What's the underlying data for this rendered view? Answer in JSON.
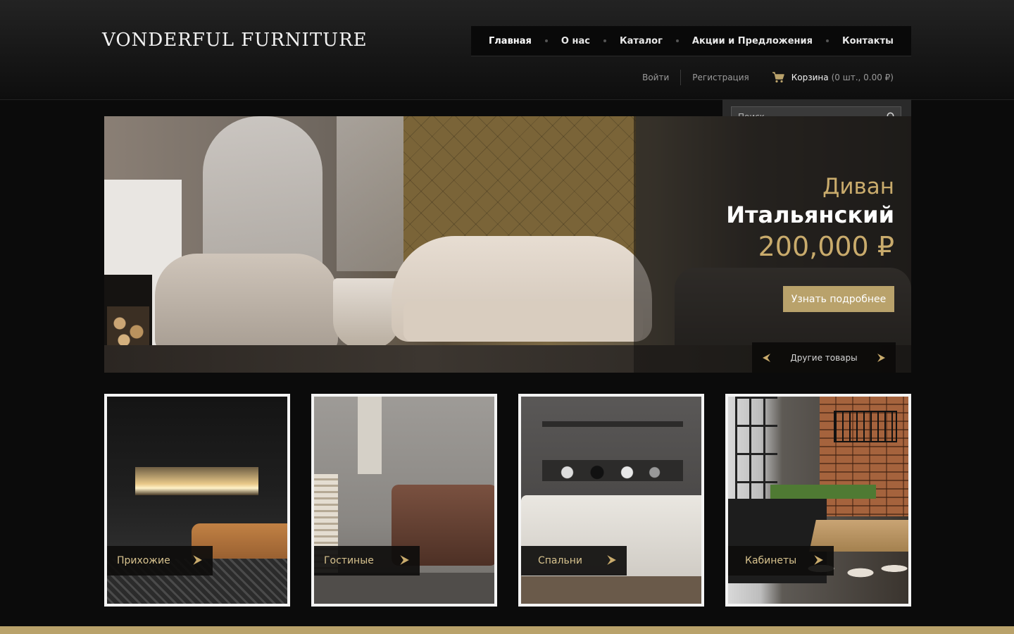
{
  "brand": {
    "logo": "VONDERFUL FURNITURE"
  },
  "nav": {
    "items": [
      {
        "label": "Главная"
      },
      {
        "label": "О нас"
      },
      {
        "label": "Каталог"
      },
      {
        "label": "Акции и Предложения"
      },
      {
        "label": "Контакты"
      }
    ]
  },
  "account": {
    "login": "Войти",
    "register": "Регистрация",
    "cart_label": "Корзина",
    "cart_summary": "(0 шт., 0.00 ₽)"
  },
  "search": {
    "placeholder": "Поиск"
  },
  "hero": {
    "title": "Диван",
    "subtitle": "Итальянский",
    "price": "200,000 ₽",
    "button": "Узнать подробнее",
    "pager_label": "Другие товары"
  },
  "categories": [
    {
      "label": "Прихожие"
    },
    {
      "label": "Гостиные"
    },
    {
      "label": "Спальни"
    },
    {
      "label": "Кабинеты"
    }
  ],
  "colors": {
    "accent": "#b9a26b",
    "accent_text": "#c9ab6c",
    "background": "#0b0b0b"
  },
  "icons": [
    "cart-icon",
    "search-icon",
    "arrow-left-icon",
    "arrow-right-icon"
  ]
}
